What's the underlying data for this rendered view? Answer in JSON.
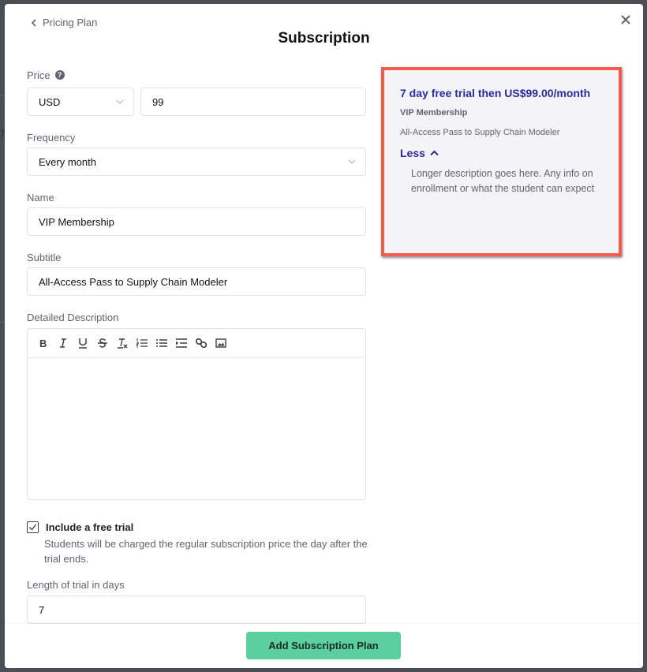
{
  "header": {
    "back_label": "Pricing Plan",
    "title": "Subscription"
  },
  "form": {
    "price": {
      "label": "Price",
      "currency": "USD",
      "amount": "99"
    },
    "frequency": {
      "label": "Frequency",
      "value": "Every month"
    },
    "name": {
      "label": "Name",
      "value": "VIP Membership"
    },
    "subtitle": {
      "label": "Subtitle",
      "value": "All-Access Pass to Supply Chain Modeler"
    },
    "description": {
      "label": "Detailed Description",
      "toolbar": [
        "bold",
        "italic",
        "underline",
        "strikethrough",
        "clear-format",
        "ordered-list",
        "bullet-list",
        "indent",
        "link",
        "image"
      ],
      "value": ""
    },
    "free_trial": {
      "checked": true,
      "label": "Include a free trial",
      "help": "Students will be charged the regular subscription price the day after the trial ends."
    },
    "trial_length": {
      "label": "Length of trial in days",
      "value": "7"
    }
  },
  "preview": {
    "headline": "7 day free trial then US$99.00/month",
    "name": "VIP Membership",
    "subtitle": "All-Access Pass to Supply Chain Modeler",
    "toggle_label": "Less",
    "description": "Longer description goes here. Any info on enrollment or what the student can expect",
    "highlight_color": "#f25c4e",
    "accent_color": "#2a2a9e"
  },
  "footer": {
    "submit_label": "Add Subscription Plan",
    "submit_color": "#5bcf9e"
  },
  "background": {
    "partial_text": "7"
  }
}
